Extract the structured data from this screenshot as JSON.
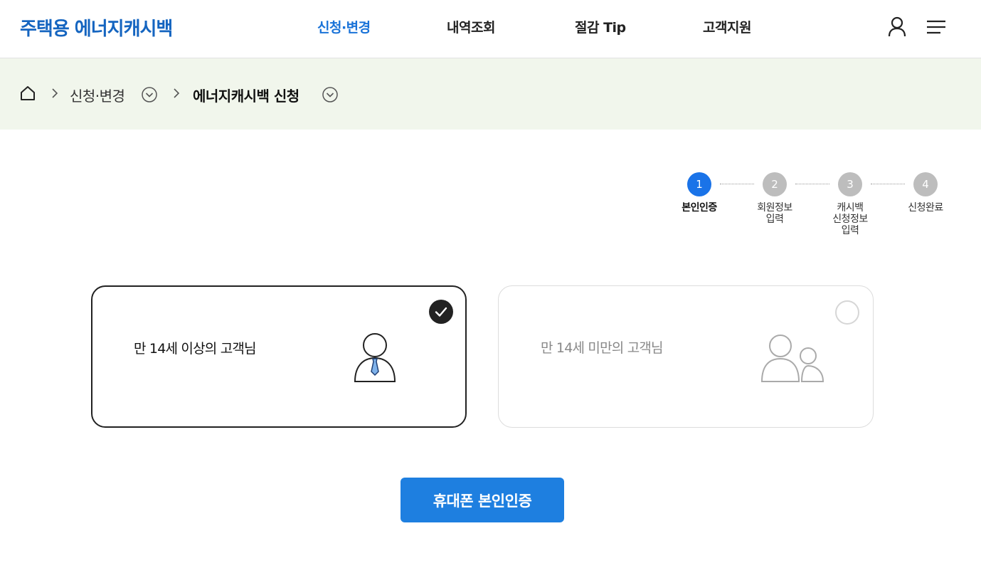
{
  "header": {
    "logo": "주택용 에너지캐시백",
    "nav": [
      {
        "label": "신청·변경",
        "active": true
      },
      {
        "label": "내역조회",
        "active": false
      },
      {
        "label": "절감 Tip",
        "active": false
      },
      {
        "label": "고객지원",
        "active": false
      }
    ],
    "icons": {
      "user": "user-icon",
      "menu": "hamburger-menu-icon"
    }
  },
  "breadcrumb": {
    "home_icon": "home-icon",
    "items": [
      {
        "label": "신청·변경"
      },
      {
        "label": "에너지캐시백 신청"
      }
    ]
  },
  "steps": [
    {
      "number": "1",
      "label": "본인인증",
      "active": true
    },
    {
      "number": "2",
      "label": "회원정보\n입력",
      "active": false
    },
    {
      "number": "3",
      "label": "캐시백\n신청정보\n입력",
      "active": false
    },
    {
      "number": "4",
      "label": "신청완료",
      "active": false
    }
  ],
  "options": [
    {
      "label": "만 14세 이상의 고객님",
      "selected": true,
      "icon": "adult-person-icon"
    },
    {
      "label": "만 14세 미만의 고객님",
      "selected": false,
      "icon": "parent-child-icon"
    }
  ],
  "cta": {
    "label": "휴대폰 본인인증"
  },
  "colors": {
    "brand": "#1565c0",
    "accent": "#1a73e8",
    "crumb_bg": "#f1f6ec",
    "cta": "#1e7fe0"
  }
}
